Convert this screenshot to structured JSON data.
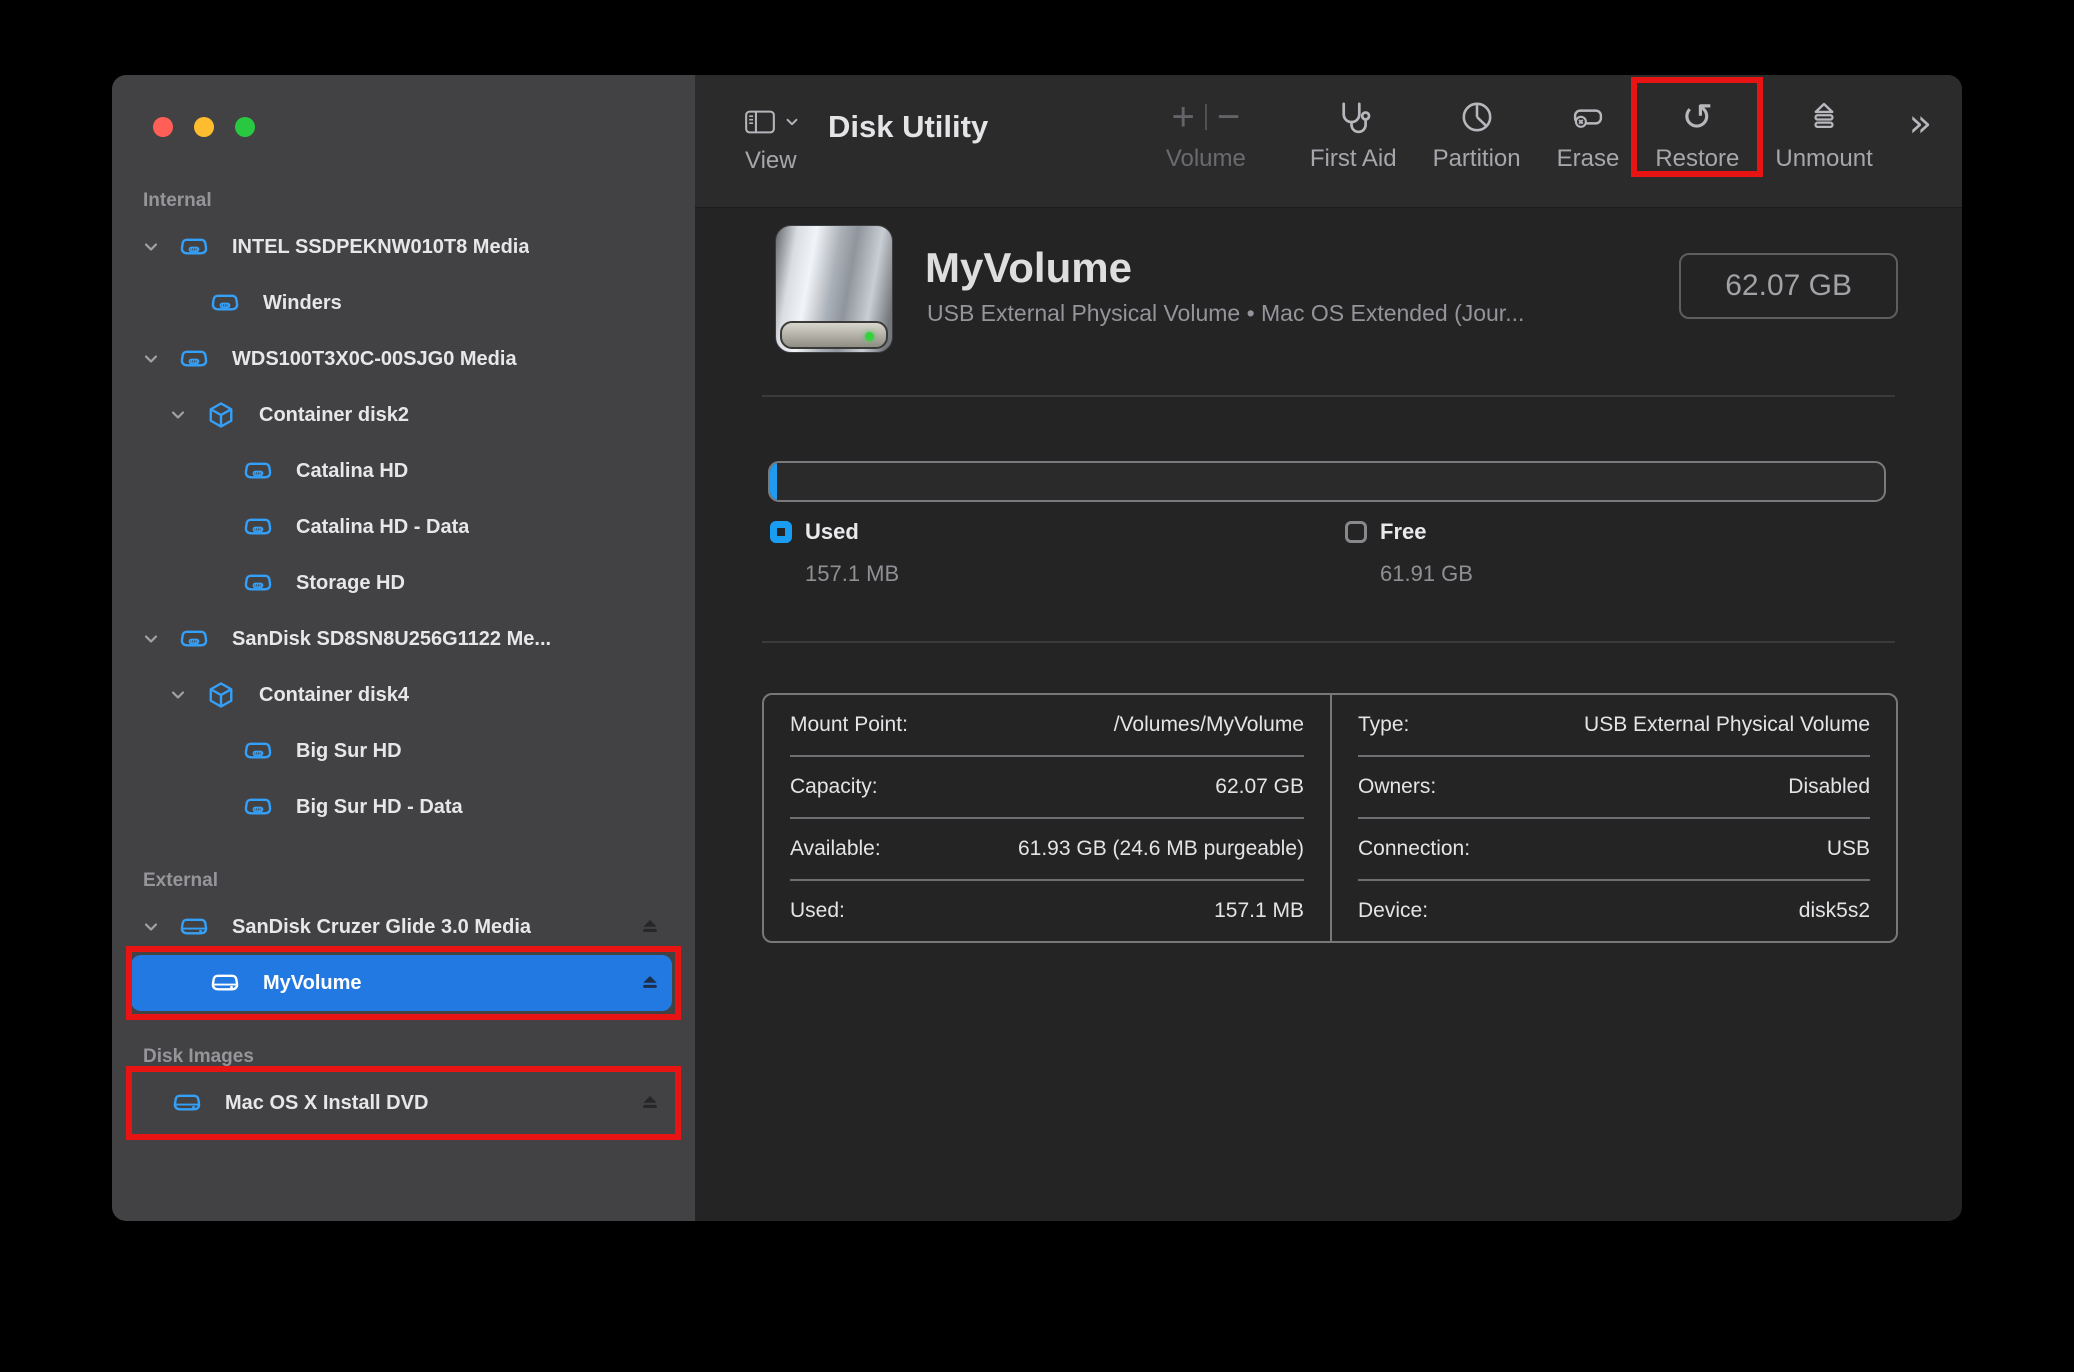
{
  "window": {
    "app_title": "Disk Utility"
  },
  "toolbar": {
    "view": {
      "label": "View"
    },
    "volume": {
      "label": "Volume",
      "plus": "+",
      "minus": "−"
    },
    "first_aid": {
      "label": "First Aid"
    },
    "partition": {
      "label": "Partition"
    },
    "erase": {
      "label": "Erase"
    },
    "restore": {
      "label": "Restore",
      "glyph": "↺"
    },
    "unmount": {
      "label": "Unmount"
    },
    "overflow": {
      "glyph": "»"
    }
  },
  "sidebar": {
    "sections": [
      {
        "header": "Internal",
        "items": [
          {
            "label": "INTEL SSDPEKNW010T8 Media"
          },
          {
            "label": "Winders"
          },
          {
            "label": "WDS100T3X0C-00SJG0 Media"
          },
          {
            "label": "Container disk2"
          },
          {
            "label": "Catalina HD"
          },
          {
            "label": "Catalina HD - Data"
          },
          {
            "label": "Storage HD"
          },
          {
            "label": "SanDisk SD8SN8U256G1122 Me..."
          },
          {
            "label": "Container disk4"
          },
          {
            "label": "Big Sur HD"
          },
          {
            "label": "Big Sur HD - Data"
          }
        ]
      },
      {
        "header": "External",
        "items": [
          {
            "label": "SanDisk Cruzer Glide 3.0 Media"
          },
          {
            "label": "MyVolume",
            "selected": true
          }
        ]
      },
      {
        "header": "Disk Images",
        "items": [
          {
            "label": "Mac OS X Install DVD"
          }
        ]
      }
    ]
  },
  "main": {
    "volume_title": "MyVolume",
    "volume_subtitle": "USB External Physical Volume • Mac OS Extended (Jour...",
    "size_badge": "62.07 GB",
    "legend": {
      "used_label": "Used",
      "used_value": "157.1 MB",
      "free_label": "Free",
      "free_value": "61.91 GB"
    },
    "details": {
      "left": [
        {
          "label": "Mount Point:",
          "value": "/Volumes/MyVolume"
        },
        {
          "label": "Capacity:",
          "value": "62.07 GB"
        },
        {
          "label": "Available:",
          "value": "61.93 GB (24.6 MB purgeable)"
        },
        {
          "label": "Used:",
          "value": "157.1 MB"
        }
      ],
      "right": [
        {
          "label": "Type:",
          "value": "USB External Physical Volume"
        },
        {
          "label": "Owners:",
          "value": "Disabled"
        },
        {
          "label": "Connection:",
          "value": "USB"
        },
        {
          "label": "Device:",
          "value": "disk5s2"
        }
      ]
    }
  },
  "colors": {
    "selection_blue": "#2379e2",
    "icon_blue": "#35a0f8",
    "used_blue": "#1f9bf0",
    "annotation_red": "#e81414"
  }
}
